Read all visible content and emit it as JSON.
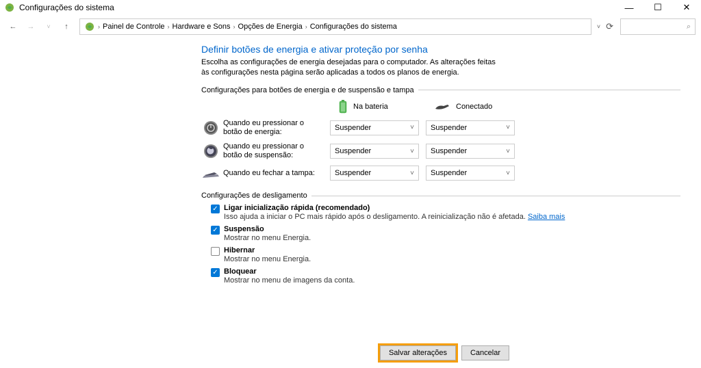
{
  "window": {
    "title": "Configurações do sistema"
  },
  "breadcrumb": {
    "items": [
      "Painel de Controle",
      "Hardware e Sons",
      "Opções de Energia",
      "Configurações do sistema"
    ]
  },
  "page": {
    "heading": "Definir botões de energia e ativar proteção por senha",
    "subtext": "Escolha as configurações de energia desejadas para o computador. As alterações feitas às configurações nesta página serão aplicadas a todos os planos de energia."
  },
  "group1": {
    "title": "Configurações para botões de energia e de suspensão e tampa",
    "col_battery": "Na bateria",
    "col_plugged": "Conectado",
    "rows": [
      {
        "label": "Quando eu pressionar o botão de energia:",
        "battery": "Suspender",
        "plugged": "Suspender"
      },
      {
        "label": "Quando eu pressionar o botão de suspensão:",
        "battery": "Suspender",
        "plugged": "Suspender"
      },
      {
        "label": "Quando eu fechar a tampa:",
        "battery": "Suspender",
        "plugged": "Suspender"
      }
    ]
  },
  "group2": {
    "title": "Configurações de desligamento",
    "items": [
      {
        "checked": true,
        "label": "Ligar inicialização rápida (recomendado)",
        "desc": "Isso ajuda a iniciar o PC mais rápido após o desligamento. A reinicialização não é afetada.",
        "link": "Saiba mais"
      },
      {
        "checked": true,
        "label": "Suspensão",
        "desc": "Mostrar no menu Energia."
      },
      {
        "checked": false,
        "label": "Hibernar",
        "desc": "Mostrar no menu Energia."
      },
      {
        "checked": true,
        "label": "Bloquear",
        "desc": "Mostrar no menu de imagens da conta."
      }
    ]
  },
  "footer": {
    "save": "Salvar alterações",
    "cancel": "Cancelar"
  }
}
